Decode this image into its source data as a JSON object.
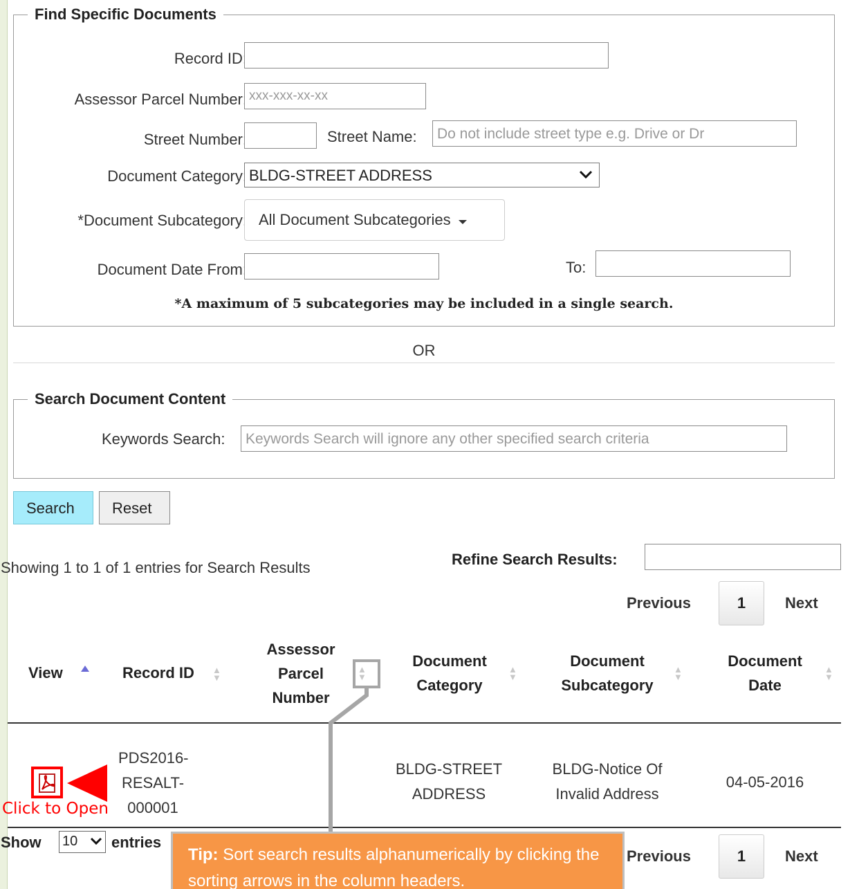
{
  "find_section": {
    "legend": "Find Specific Documents",
    "record_id_label": "Record ID:",
    "record_id_value": "",
    "apn_label": "Assessor Parcel Number:",
    "apn_placeholder": "xxx-xxx-xx-xx",
    "street_number_label": "Street Number:",
    "street_name_label": "Street Name:",
    "street_name_placeholder": "Do not include street type e.g. Drive or Dr",
    "doc_category_label": "Document Category:",
    "doc_category_value": "BLDG-STREET ADDRESS",
    "doc_subcategory_label": "*Document Subcategory:",
    "doc_subcategory_value": "All Document Subcategories",
    "date_from_label": "Document Date From:",
    "date_to_label": "To:",
    "note": "*A maximum of 5 subcategories may be included in a single search."
  },
  "or_text": "OR",
  "content_section": {
    "legend": "Search Document Content",
    "keywords_label": "Keywords Search:",
    "keywords_placeholder": "Keywords Search will ignore any other specified search criteria"
  },
  "buttons": {
    "search": "Search",
    "reset": "Reset"
  },
  "results": {
    "summary": "Showing 1 to 1 of 1 entries for Search Results",
    "refine_label": "Refine Search Results:",
    "pagination": {
      "previous": "Previous",
      "current": "1",
      "next": "Next"
    },
    "columns": [
      {
        "lines": [
          "View"
        ]
      },
      {
        "lines": [
          "Record ID"
        ]
      },
      {
        "lines": [
          "Assessor",
          "Parcel",
          "Number"
        ]
      },
      {
        "lines": [
          "Document",
          "Category"
        ]
      },
      {
        "lines": [
          "Document",
          "Subcategory"
        ]
      },
      {
        "lines": [
          "Document",
          "Date"
        ]
      }
    ],
    "rows": [
      {
        "record_id": [
          "PDS2016-",
          "RESALT-",
          "000001"
        ],
        "apn": "",
        "category": [
          "BLDG-STREET",
          "ADDRESS"
        ],
        "subcategory": [
          "BLDG-Notice Of",
          "Invalid Address"
        ],
        "date": "04-05-2016"
      }
    ],
    "show_label": "Show",
    "show_value": "10",
    "entries_label": "entries"
  },
  "annotations": {
    "click_to_open": "Click to Open",
    "tip_label": "Tip:",
    "tip_text": "Sort search results alphanumerically by clicking the sorting arrows in the column headers."
  },
  "colors": {
    "background": "#ebf1de",
    "search_button": "#a6ecfb",
    "annotation_red": "#ff0000",
    "tip_orange": "#f79646"
  },
  "icons": {
    "sort_asc": "triangle-up-icon",
    "sort_both": "sort-arrows-icon",
    "pdf": "pdf-icon",
    "chevron": "chevron-down-icon",
    "caret": "caret-down-icon"
  }
}
